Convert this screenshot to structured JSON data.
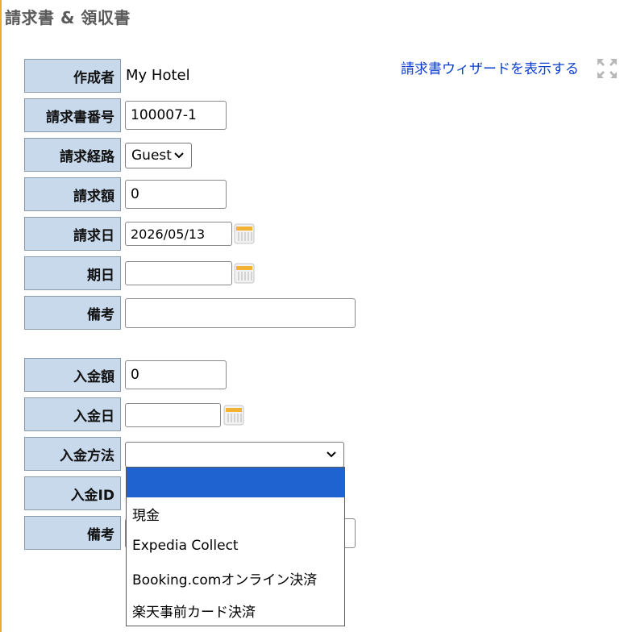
{
  "header": {
    "title": "請求書 & 領収書"
  },
  "wizard_link": {
    "label": "請求書ウィザードを表示する"
  },
  "invoice": {
    "creator_label": "作成者",
    "creator_value": "My Hotel",
    "number_label": "請求書番号",
    "number_value": "100007-1",
    "route_label": "請求経路",
    "route_value": "Guest",
    "amount_label": "請求額",
    "amount_value": "0",
    "date_label": "請求日",
    "date_value": "2026/05/13",
    "due_label": "期日",
    "due_value": "",
    "note_label": "備考",
    "note_value": ""
  },
  "payment": {
    "amount_label": "入金額",
    "amount_value": "0",
    "date_label": "入金日",
    "date_value": "",
    "method_label": "入金方法",
    "method_value": "",
    "id_label": "入金ID",
    "note_label": "備考"
  },
  "method_dropdown": {
    "options": [
      "",
      "現金",
      "Expedia Collect",
      "Booking.comオンライン決済",
      "楽天事前カード決済"
    ],
    "selected_index": 0
  },
  "icons": {
    "calendar": "calendar-icon",
    "expand": "expand-icon",
    "chevron": "chevron-down-icon"
  },
  "colors": {
    "label_bg": "#c8d9ec",
    "link": "#0b3ed0",
    "selected_option": "#1e63d0",
    "title": "#5a5a5a",
    "accent": "#f0a830"
  }
}
